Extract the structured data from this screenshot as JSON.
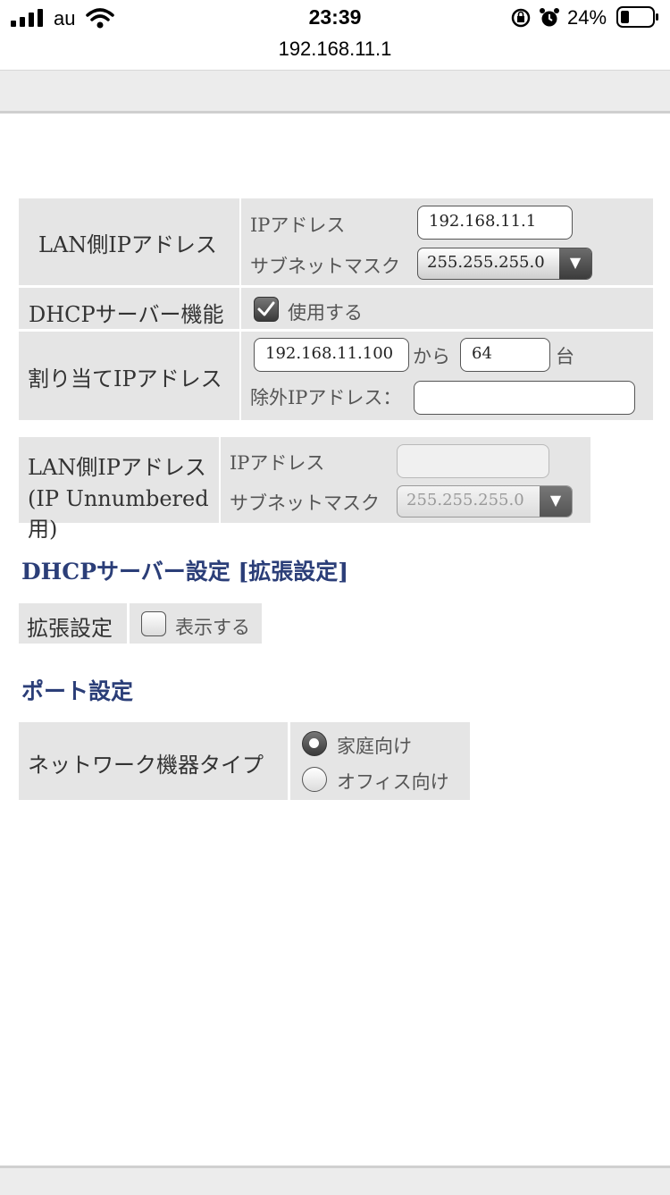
{
  "status_bar": {
    "carrier": "au",
    "time": "23:39",
    "battery": "24%",
    "url": "192.168.11.1"
  },
  "lan": {
    "label": "LAN側IPアドレス",
    "ip_label": "IPアドレス",
    "ip_value": "192.168.11.1",
    "mask_label": "サブネットマスク",
    "mask_value": "255.255.255.0"
  },
  "dhcp": {
    "label": "DHCPサーバー機能",
    "use_label": "使用する",
    "use_checked": true
  },
  "assign": {
    "label": "割り当てIPアドレス",
    "start_value": "192.168.11.100",
    "from_label": "から",
    "count_value": "64",
    "unit_label": "台",
    "exclude_label": "除外IPアドレス：",
    "exclude_value": ""
  },
  "unnumbered": {
    "label_line1": "LAN側IPアドレス",
    "label_line2": "(IP Unnumbered用)",
    "ip_label": "IPアドレス",
    "ip_value": "",
    "mask_label": "サブネットマスク",
    "mask_value": "255.255.255.0"
  },
  "dhcp_ext": {
    "heading": "DHCPサーバー設定 [拡張設定]",
    "label": "拡張設定",
    "show_label": "表示する",
    "show_checked": false
  },
  "port": {
    "heading": "ポート設定",
    "label": "ネットワーク機器タイプ",
    "options": [
      "家庭向け",
      "オフィス向け"
    ],
    "selected": "家庭向け"
  }
}
